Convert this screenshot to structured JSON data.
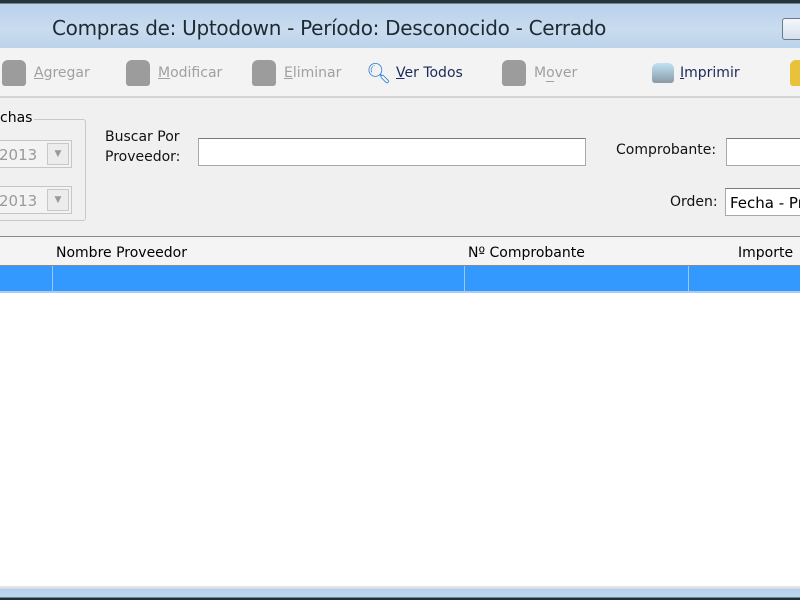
{
  "window": {
    "title": "Compras de: Uptodown - Período: Desconocido - Cerrado"
  },
  "toolbar": {
    "agregar": {
      "label": "Agregar",
      "key": "A",
      "rest": "gregar"
    },
    "modificar": {
      "label": "Modificar",
      "key": "M",
      "rest": "odificar"
    },
    "eliminar": {
      "label": "Eliminar",
      "key": "E",
      "rest": "liminar"
    },
    "ver_todos": {
      "label": "Ver Todos",
      "key": "V",
      "rest": "er Todos"
    },
    "mover": {
      "label": "Mover",
      "pre": "M",
      "key": "o",
      "rest": "ver"
    },
    "imprimir": {
      "label": "Imprimir",
      "key": "I",
      "rest": "mprimir"
    }
  },
  "filters": {
    "fechas_label": "chas",
    "desde_value": "2013",
    "hasta_value": "2013",
    "buscar_label_1": "Buscar Por",
    "buscar_label_2": "Proveedor:",
    "buscar_value": "",
    "comprobante_label": "Comprobante:",
    "comprobante_value": "",
    "orden_label": "Orden:",
    "orden_value": "Fecha - Pr"
  },
  "grid": {
    "columns": [
      "",
      "Nombre Proveedor",
      "Nº Comprobante",
      "Importe"
    ]
  },
  "colors": {
    "selection": "#3399ff"
  }
}
